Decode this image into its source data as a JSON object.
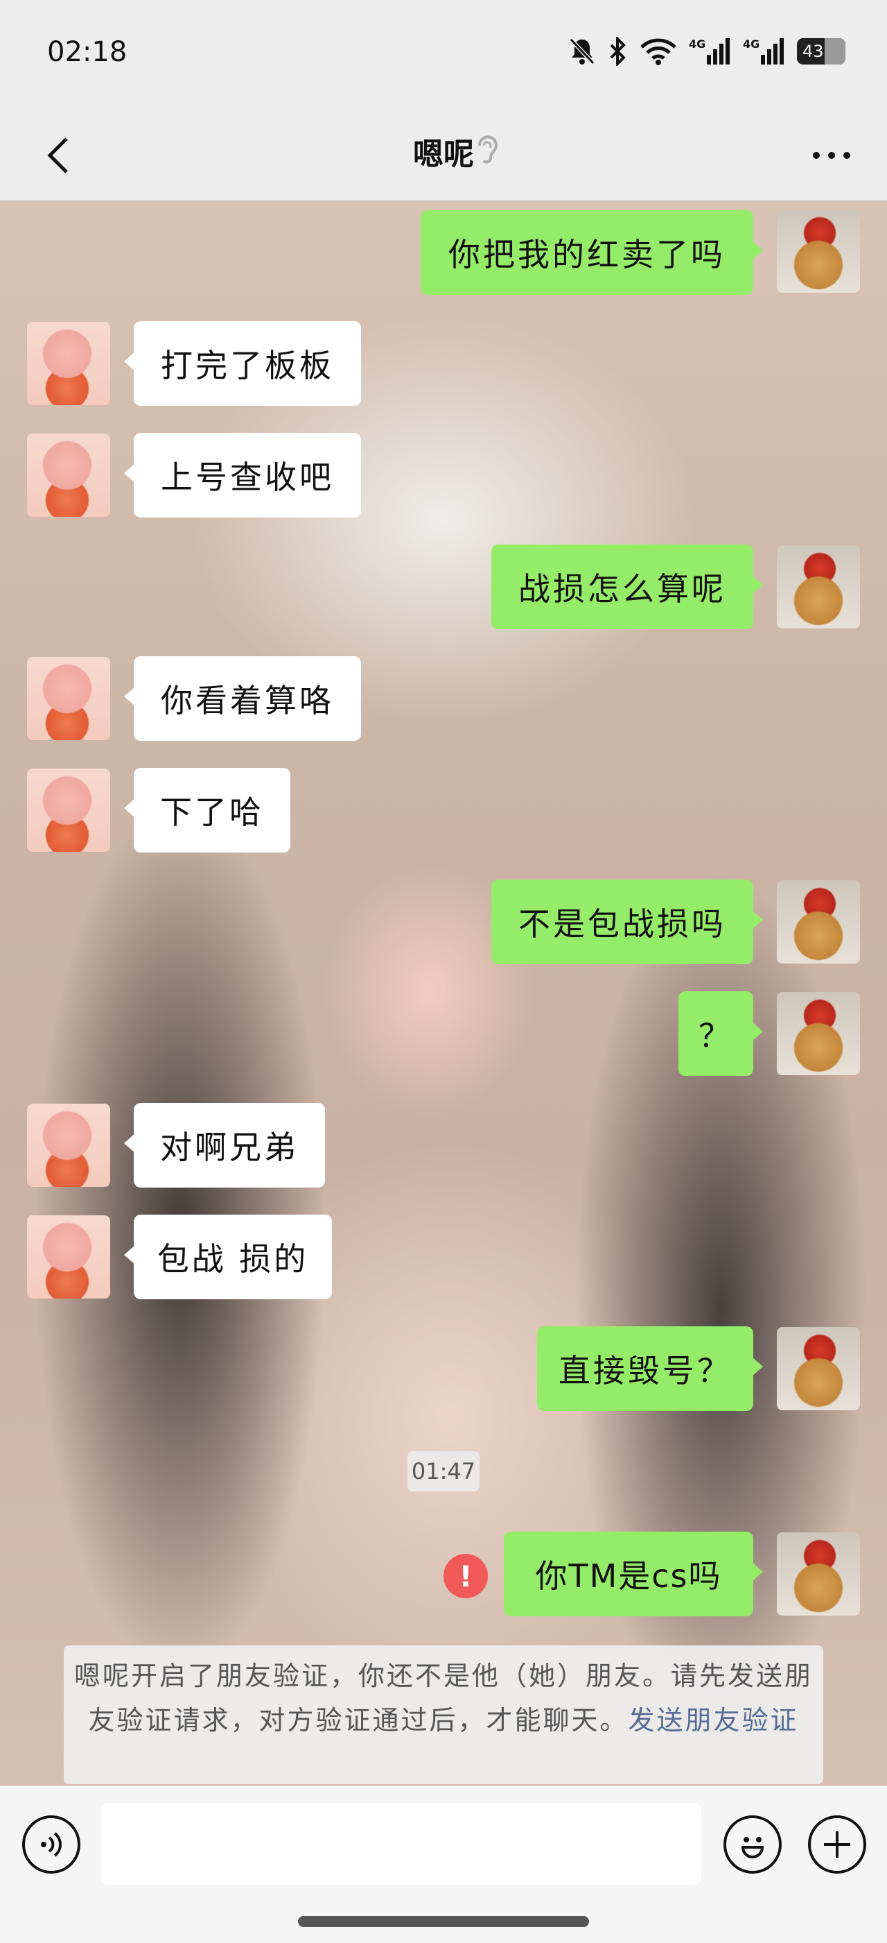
{
  "status": {
    "time": "02:18",
    "battery": "43",
    "net1": "4G",
    "net2": "4G"
  },
  "header": {
    "title": "嗯呢"
  },
  "messages": [
    {
      "side": "right",
      "text": "你把我的红卖了吗"
    },
    {
      "side": "left",
      "text": "打完了板板"
    },
    {
      "side": "left",
      "text": "上号查收吧"
    },
    {
      "side": "right",
      "text": "战损怎么算呢"
    },
    {
      "side": "left",
      "text": "你看着算咯"
    },
    {
      "side": "left",
      "text": "下了哈"
    },
    {
      "side": "right",
      "text": "不是包战损吗"
    },
    {
      "side": "right",
      "text": "？"
    },
    {
      "side": "left",
      "text": "对啊兄弟"
    },
    {
      "side": "left",
      "text": "包战 损的"
    },
    {
      "side": "right",
      "text": "直接毁号？"
    },
    {
      "side": "right",
      "text": "你TM是cs吗",
      "failed": true
    }
  ],
  "timestamp": "01:47",
  "error_mark": "!",
  "notice": {
    "text": "嗯呢开启了朋友验证，你还不是他（她）朋友。请先发送朋友验证请求，对方验证通过后，才能聊天。",
    "link": "发送朋友验证"
  },
  "footer": {
    "input_value": ""
  }
}
